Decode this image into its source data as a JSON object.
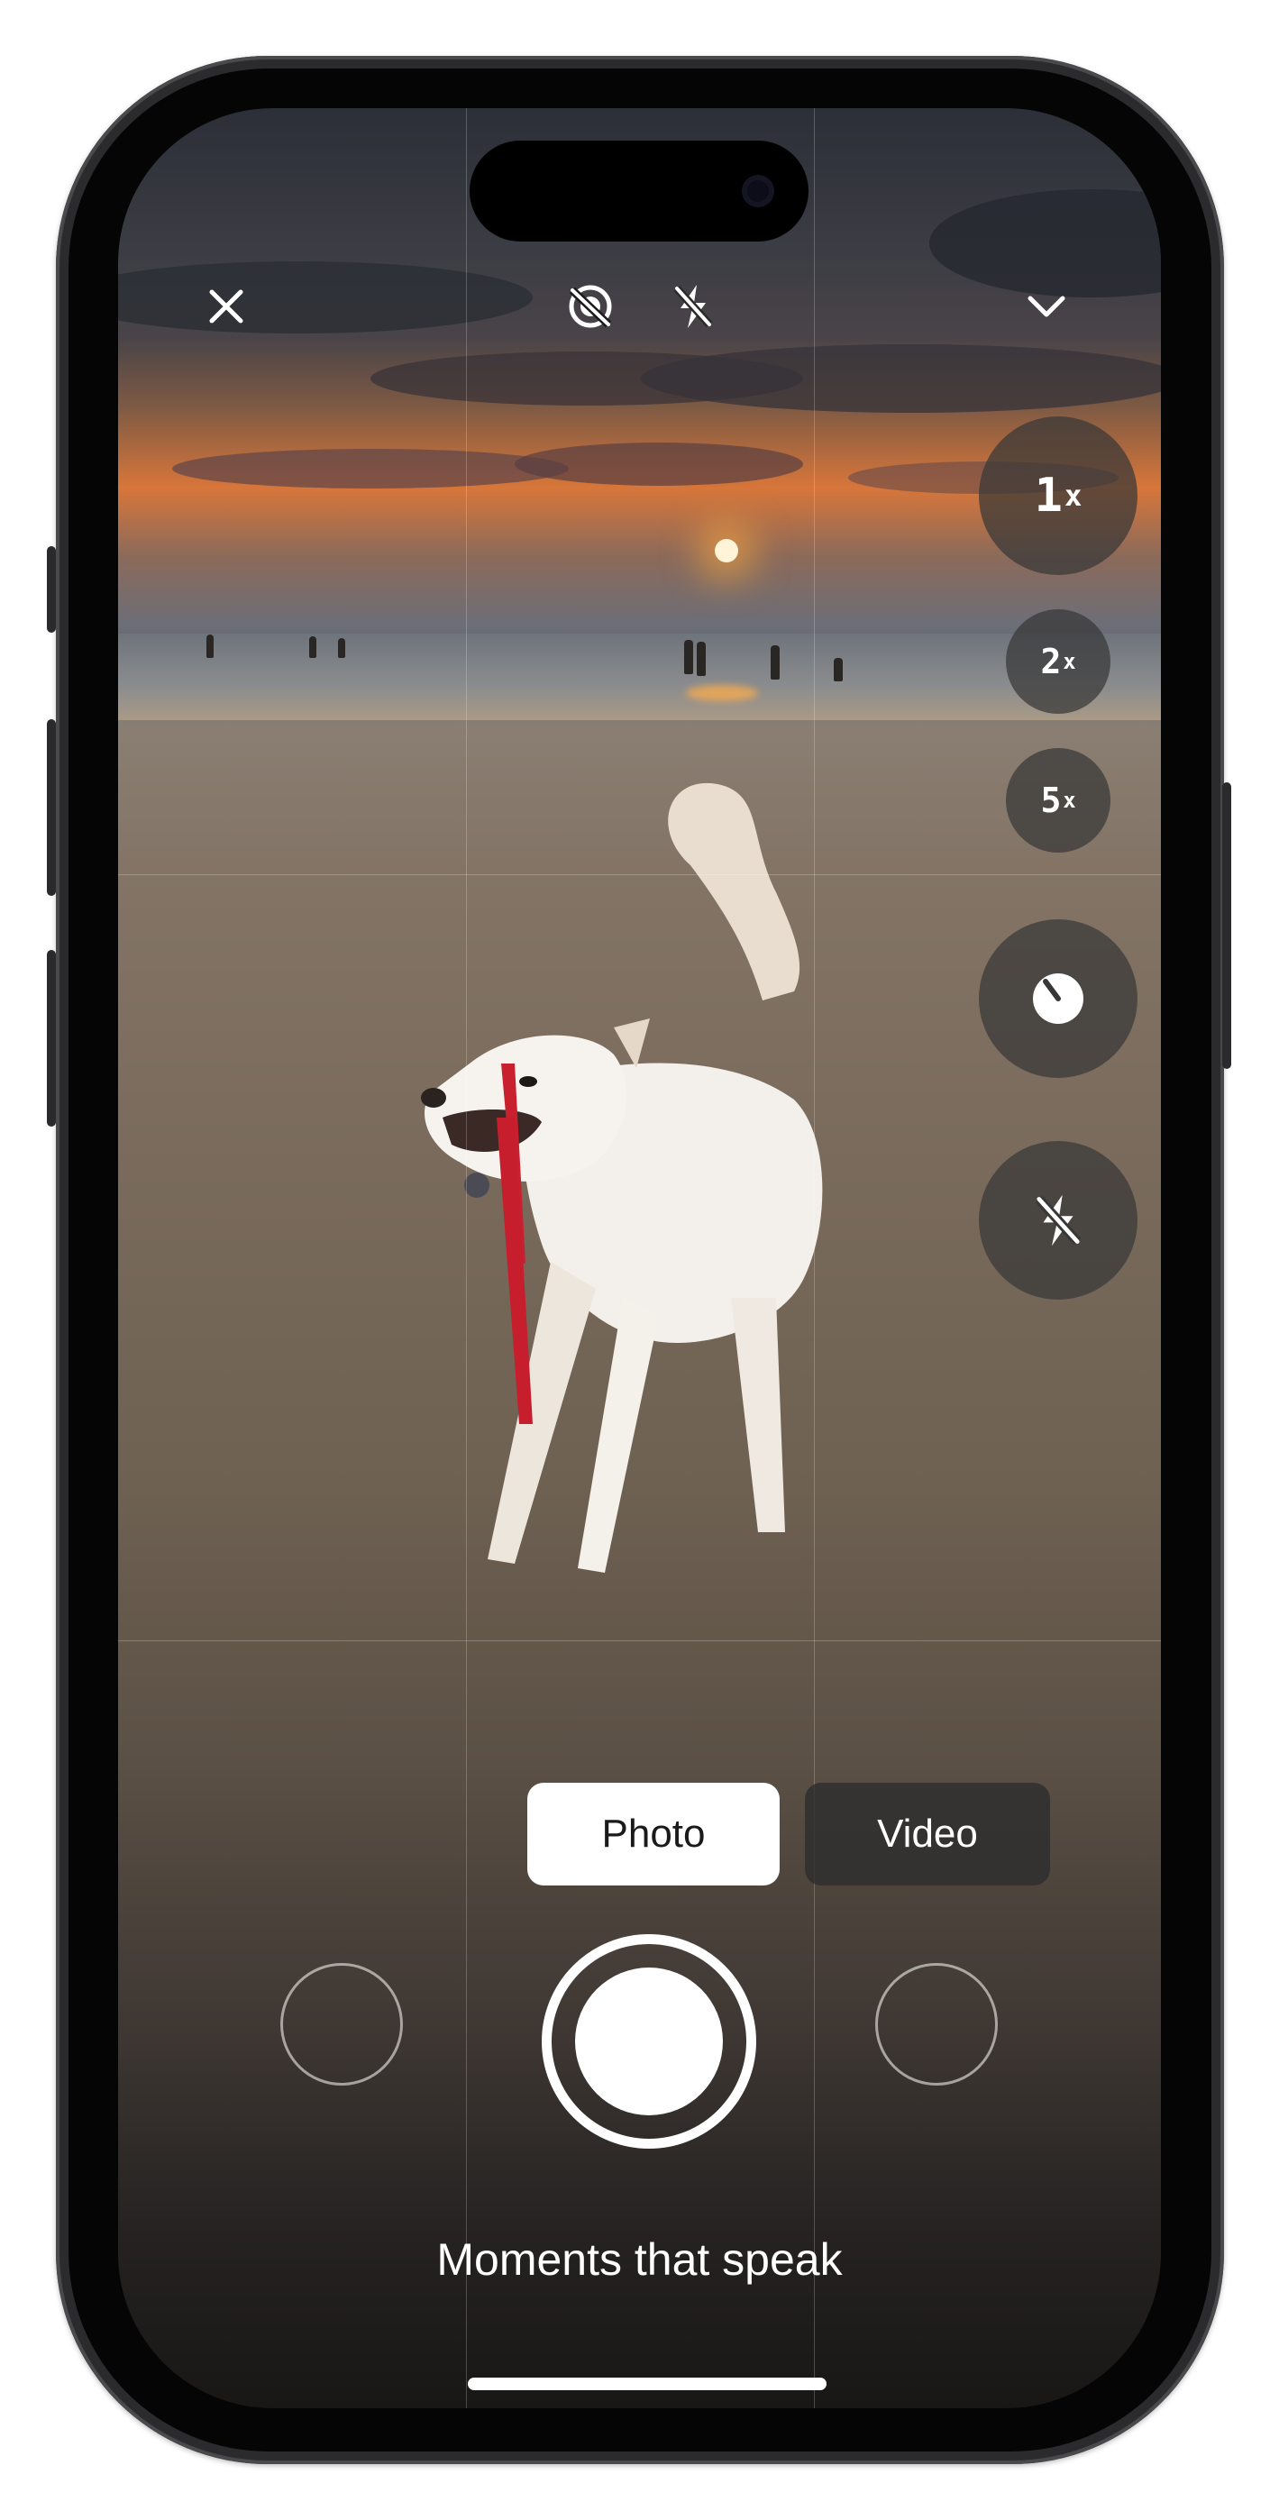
{
  "camera": {
    "top_bar": {
      "close_icon": "close-icon",
      "live_photo_off_icon": "live-photo-off-icon",
      "flash_off_icon": "flash-off-icon",
      "collapse_icon": "chevron-down-icon"
    },
    "zoom_levels": [
      {
        "num": "1",
        "suffix": "x",
        "selected": true
      },
      {
        "num": "2",
        "suffix": "x",
        "selected": false
      },
      {
        "num": "5",
        "suffix": "x",
        "selected": false
      }
    ],
    "side_controls": [
      "timer-icon",
      "flash-off-icon"
    ],
    "modes": {
      "photo": "Photo",
      "video": "Video",
      "active": "photo"
    },
    "tagline": "Moments that speak"
  },
  "colors": {
    "accent": "#ffffff",
    "control_bg": "#373737",
    "phone_frame": "#2b2b2d"
  }
}
